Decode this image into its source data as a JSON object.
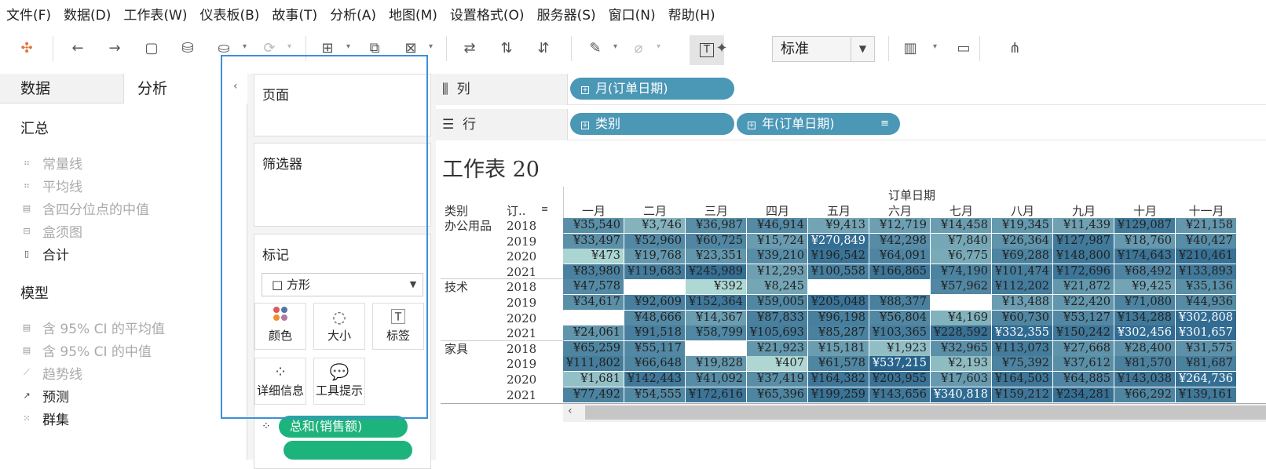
{
  "menu": [
    "文件(F)",
    "数据(D)",
    "工作表(W)",
    "仪表板(B)",
    "故事(T)",
    "分析(A)",
    "地图(M)",
    "设置格式(O)",
    "服务器(S)",
    "窗口(N)",
    "帮助(H)"
  ],
  "toolbar": {
    "fit_mode": "标准"
  },
  "left_panel": {
    "tabs": [
      "数据",
      "分析"
    ],
    "summary_title": "汇总",
    "summary_items": [
      {
        "label": "常量线",
        "enabled": false
      },
      {
        "label": "平均线",
        "enabled": false
      },
      {
        "label": "含四分位点的中值",
        "enabled": false
      },
      {
        "label": "盒须图",
        "enabled": false
      },
      {
        "label": "合计",
        "enabled": true
      }
    ],
    "model_title": "模型",
    "model_items": [
      {
        "label": "含 95% CI 的平均值",
        "enabled": false
      },
      {
        "label": "含 95% CI 的中值",
        "enabled": false
      },
      {
        "label": "趋势线",
        "enabled": false
      },
      {
        "label": "预测",
        "enabled": true
      },
      {
        "label": "群集",
        "enabled": true
      }
    ]
  },
  "cards": {
    "pages": "页面",
    "filters": "筛选器",
    "marks": "标记",
    "mark_type": "方形",
    "buttons": [
      "颜色",
      "大小",
      "标签",
      "详细信息",
      "工具提示"
    ],
    "color_pill": "总和(销售额)"
  },
  "shelves": {
    "columns_label": "列",
    "rows_label": "行",
    "columns_pills": [
      "月(订单日期)"
    ],
    "rows_pills": [
      "类别",
      "年(订单日期)"
    ]
  },
  "viz": {
    "title": "工作表 20",
    "col_header_title": "订单日期",
    "row_header_1": "类别",
    "row_header_2": "订..",
    "months": [
      "一月",
      "二月",
      "三月",
      "四月",
      "五月",
      "六月",
      "七月",
      "八月",
      "九月",
      "十月",
      "十一月"
    ],
    "categories": [
      {
        "name": "办公用品",
        "rows": [
          {
            "year": "2018",
            "values": [
              "¥35,540",
              "¥3,746",
              "¥36,987",
              "¥46,914",
              "¥9,413",
              "¥12,719",
              "¥14,458",
              "¥19,345",
              "¥11,439",
              "¥129,087",
              "¥21,158"
            ]
          },
          {
            "year": "2019",
            "values": [
              "¥33,497",
              "¥52,960",
              "¥60,725",
              "¥15,724",
              "¥270,849",
              "¥42,298",
              "¥7,840",
              "¥26,364",
              "¥127,987",
              "¥18,760",
              "¥40,427"
            ]
          },
          {
            "year": "2020",
            "values": [
              "¥473",
              "¥19,768",
              "¥23,351",
              "¥39,210",
              "¥196,542",
              "¥64,091",
              "¥6,775",
              "¥69,288",
              "¥148,800",
              "¥174,643",
              "¥210,461"
            ]
          },
          {
            "year": "2021",
            "values": [
              "¥83,980",
              "¥119,683",
              "¥245,989",
              "¥12,293",
              "¥100,558",
              "¥166,865",
              "¥74,190",
              "¥101,474",
              "¥172,696",
              "¥68,492",
              "¥133,893"
            ]
          }
        ]
      },
      {
        "name": "技术",
        "rows": [
          {
            "year": "2018",
            "values": [
              "¥47,578",
              "",
              "¥392",
              "¥8,245",
              "",
              "",
              "¥57,962",
              "¥112,202",
              "¥21,872",
              "¥9,425",
              "¥35,136"
            ]
          },
          {
            "year": "2019",
            "values": [
              "¥34,617",
              "¥92,609",
              "¥152,364",
              "¥59,005",
              "¥205,048",
              "¥88,377",
              "",
              "¥13,488",
              "¥22,420",
              "¥71,080",
              "¥44,936"
            ]
          },
          {
            "year": "2020",
            "values": [
              "",
              "¥48,666",
              "¥14,367",
              "¥87,833",
              "¥96,198",
              "¥56,804",
              "¥4,169",
              "¥60,730",
              "¥53,127",
              "¥134,288",
              "¥302,808"
            ]
          },
          {
            "year": "2021",
            "values": [
              "¥24,061",
              "¥91,518",
              "¥58,799",
              "¥105,693",
              "¥85,287",
              "¥103,365",
              "¥228,592",
              "¥332,355",
              "¥150,242",
              "¥302,456",
              "¥301,657"
            ]
          }
        ]
      },
      {
        "name": "家具",
        "rows": [
          {
            "year": "2018",
            "values": [
              "¥65,259",
              "¥55,117",
              "",
              "¥21,923",
              "¥15,181",
              "¥1,923",
              "¥32,965",
              "¥113,073",
              "¥27,668",
              "¥28,400",
              "¥31,575"
            ]
          },
          {
            "year": "2019",
            "values": [
              "¥111,802",
              "¥66,648",
              "¥19,828",
              "¥407",
              "¥61,578",
              "¥537,215",
              "¥2,193",
              "¥75,392",
              "¥37,612",
              "¥81,570",
              "¥81,687"
            ]
          },
          {
            "year": "2020",
            "values": [
              "¥1,681",
              "¥142,443",
              "¥41,092",
              "¥37,419",
              "¥164,382",
              "¥203,955",
              "¥17,603",
              "¥164,503",
              "¥64,885",
              "¥143,038",
              "¥264,736"
            ]
          },
          {
            "year": "2021",
            "values": [
              "¥77,492",
              "¥54,555",
              "¥172,616",
              "¥65,396",
              "¥199,259",
              "¥143,656",
              "¥340,818",
              "¥159,212",
              "¥234,281",
              "¥66,292",
              "¥139,161"
            ]
          }
        ]
      }
    ]
  }
}
